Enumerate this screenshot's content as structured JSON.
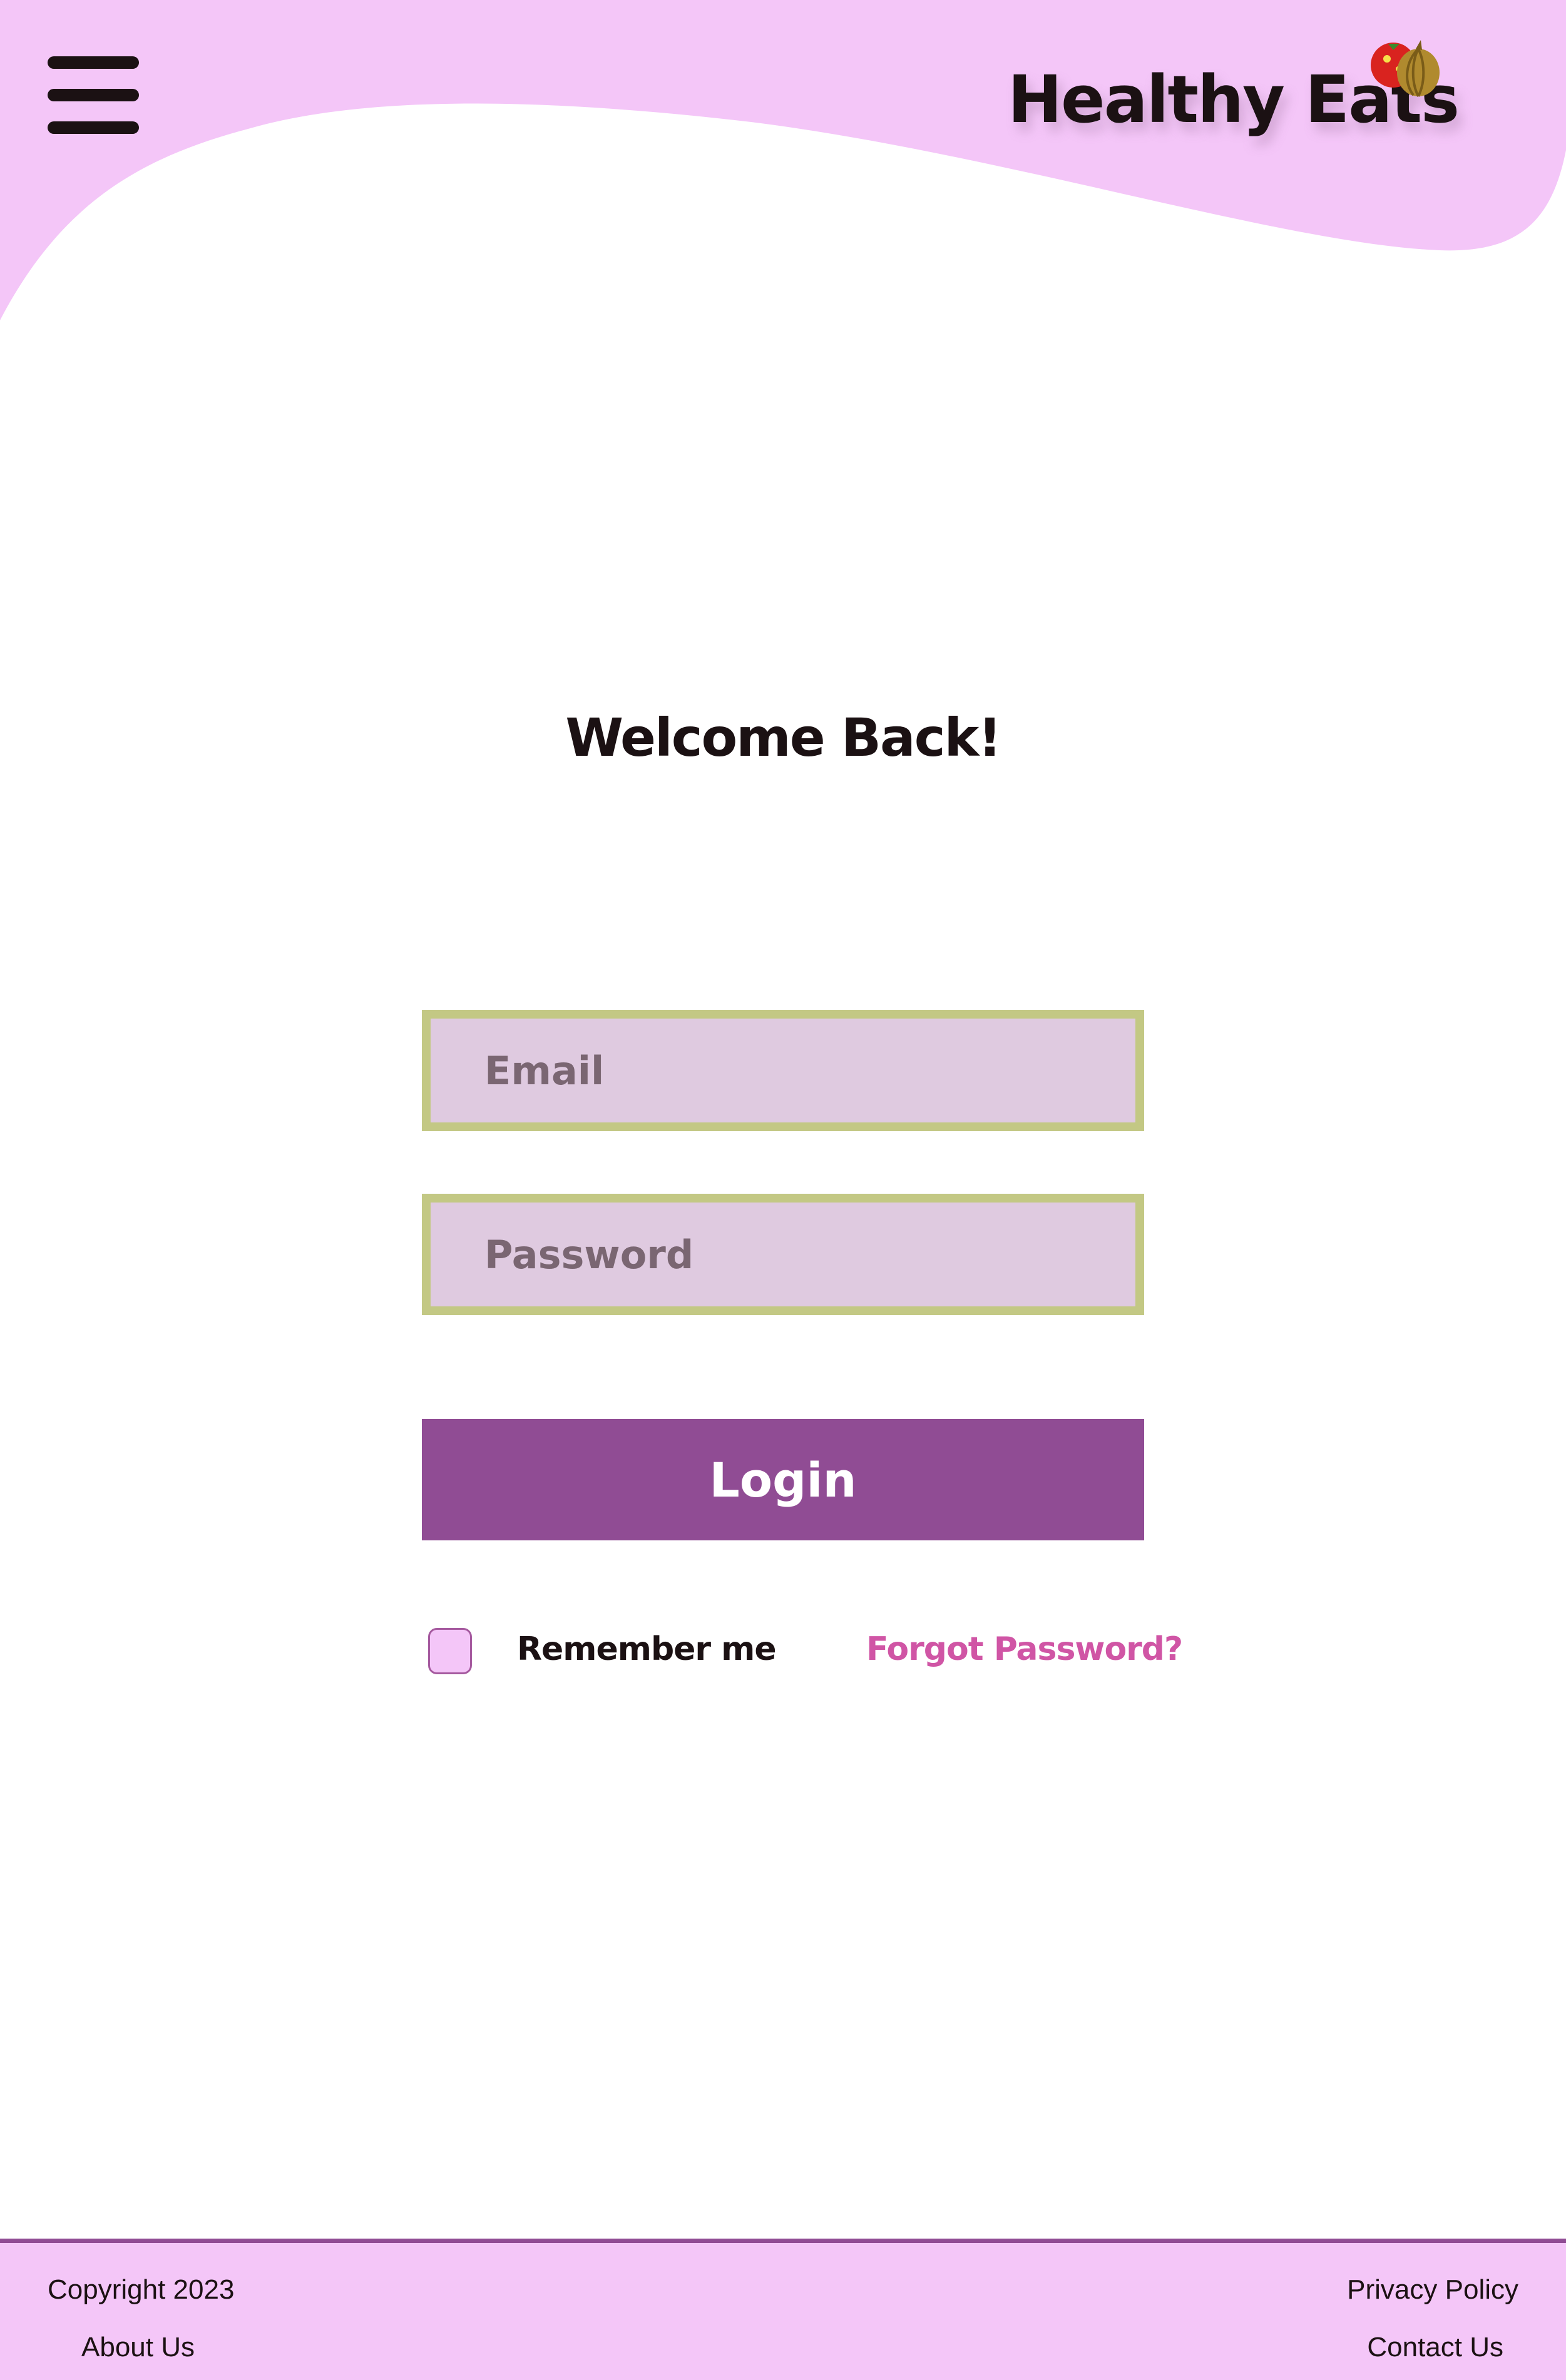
{
  "header": {
    "menu_icon": "hamburger-menu-icon",
    "brand_name": "Healthy Eats",
    "brand_icon": "tomato-onion-icon"
  },
  "main": {
    "title": "Welcome Back!",
    "email_placeholder": "Email",
    "password_placeholder": "Password",
    "login_label": "Login",
    "remember_label": "Remember me",
    "forgot_label": "Forgot Password?"
  },
  "footer": {
    "copyright": "Copyright 2023",
    "about": "About Us",
    "privacy": "Privacy Policy",
    "contact": "Contact Us"
  },
  "colors": {
    "accent_pink": "#f4c6f8",
    "primary_purple": "#904c94",
    "field_fill": "#dfcae0",
    "field_border": "#c3c884",
    "link_pink": "#d055a5",
    "text_dark": "#1b1113"
  }
}
